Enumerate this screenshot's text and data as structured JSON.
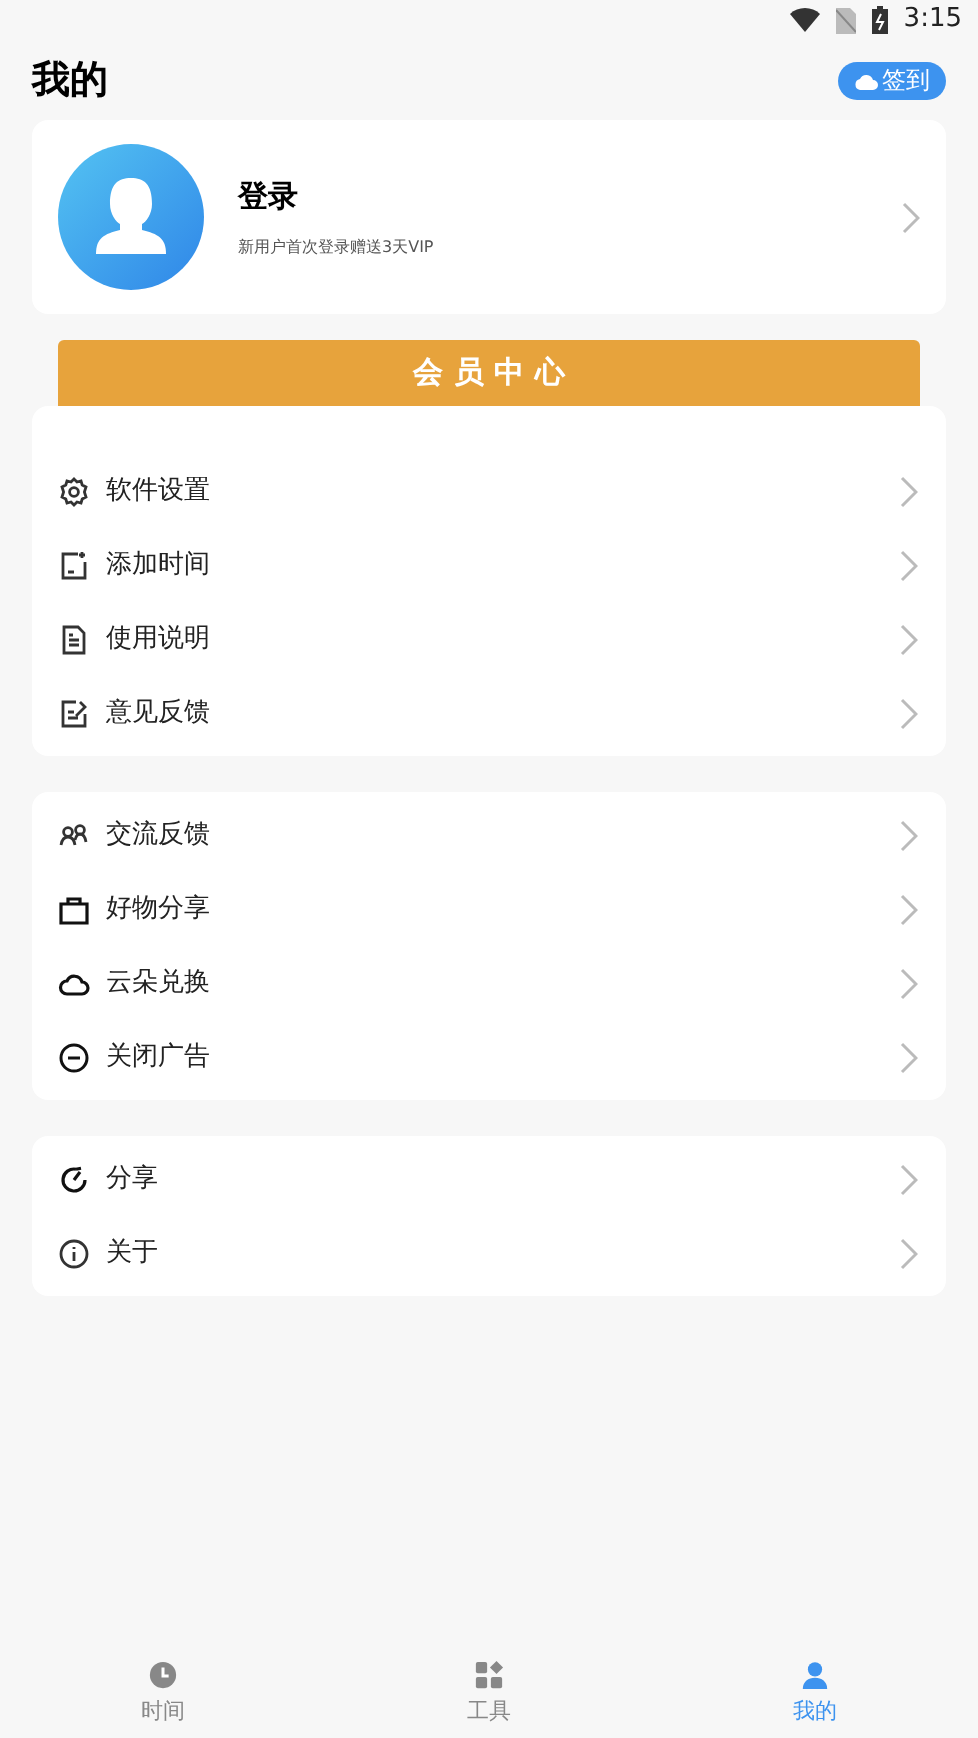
{
  "status_bar": {
    "time": "3:15"
  },
  "header": {
    "title": "我的",
    "checkin_button": "签到"
  },
  "profile": {
    "name": "登录",
    "subtitle": "新用户首次登录赠送3天VIP"
  },
  "vip_banner": "会 员 中 心",
  "groups": [
    {
      "items": [
        {
          "label": "软件设置",
          "kind": "gear"
        },
        {
          "label": "添加时间",
          "kind": "note"
        },
        {
          "label": "使用说明",
          "kind": "doc"
        },
        {
          "label": "意见反馈",
          "kind": "edit"
        }
      ]
    },
    {
      "items": [
        {
          "label": "交流反馈",
          "kind": "people"
        },
        {
          "label": "好物分享",
          "kind": "bag"
        },
        {
          "label": "云朵兑换",
          "kind": "cloud"
        },
        {
          "label": "关闭广告",
          "kind": "minus"
        }
      ]
    },
    {
      "items": [
        {
          "label": "分享",
          "kind": "refresh"
        },
        {
          "label": "关于",
          "kind": "info"
        }
      ]
    }
  ],
  "tabs": [
    {
      "label": "时间",
      "kind": "clock",
      "selected": false
    },
    {
      "label": "工具",
      "kind": "grid",
      "selected": false
    },
    {
      "label": "我的",
      "kind": "person",
      "selected": true
    }
  ]
}
